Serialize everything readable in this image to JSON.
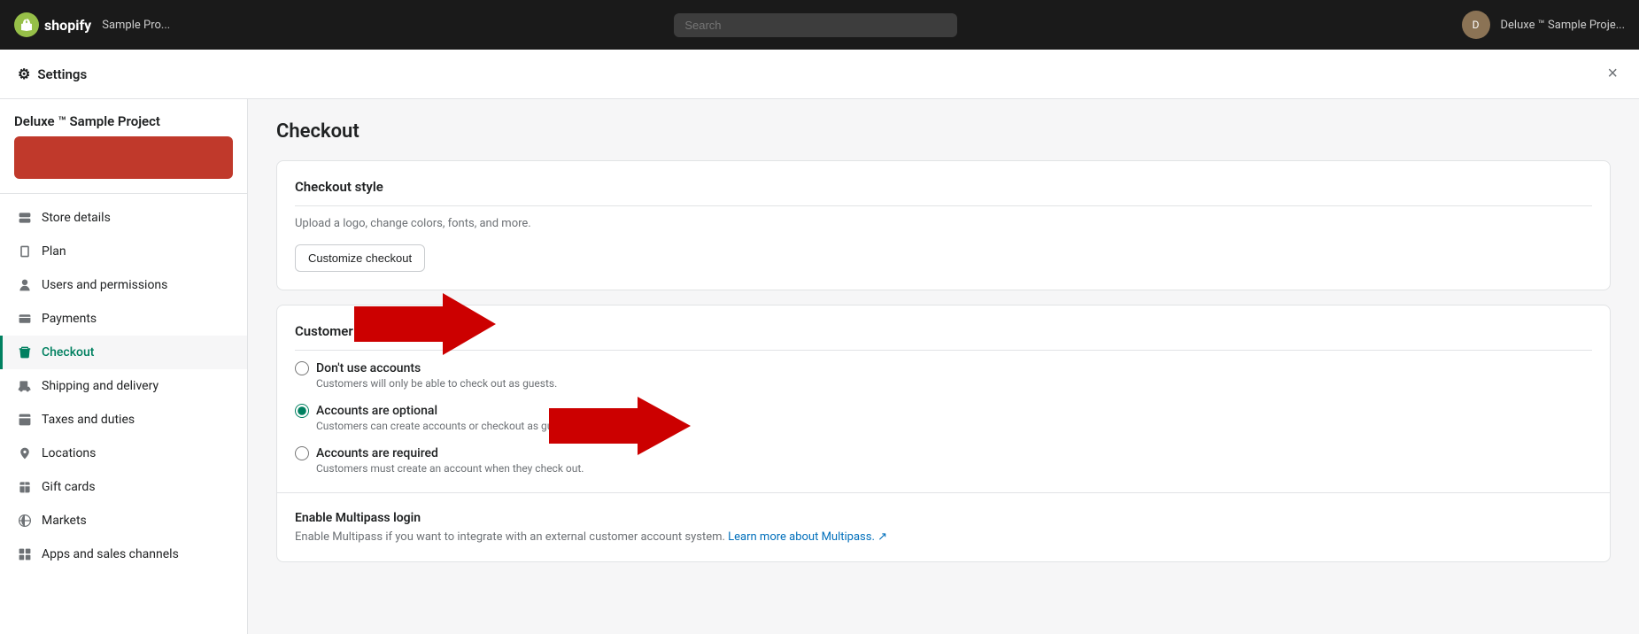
{
  "topbar": {
    "logo_text": "shopify",
    "store_name": "Sample Pro...",
    "search_placeholder": "Search",
    "user_label": "Deluxe ™ Sample Proje..."
  },
  "settings": {
    "title": "Settings",
    "close_label": "×"
  },
  "sidebar": {
    "store_title": "Deluxe ™ Sample Project",
    "nav_items": [
      {
        "id": "store-details",
        "label": "Store details",
        "icon": "🏪"
      },
      {
        "id": "plan",
        "label": "Plan",
        "icon": "📄"
      },
      {
        "id": "users-permissions",
        "label": "Users and permissions",
        "icon": "👤"
      },
      {
        "id": "payments",
        "label": "Payments",
        "icon": "💳"
      },
      {
        "id": "checkout",
        "label": "Checkout",
        "icon": "🛒",
        "active": true
      },
      {
        "id": "shipping-delivery",
        "label": "Shipping and delivery",
        "icon": "🚚"
      },
      {
        "id": "taxes-duties",
        "label": "Taxes and duties",
        "icon": "🏷️"
      },
      {
        "id": "locations",
        "label": "Locations",
        "icon": "📍"
      },
      {
        "id": "gift-cards",
        "label": "Gift cards",
        "icon": "🎁"
      },
      {
        "id": "markets",
        "label": "Markets",
        "icon": "🌐"
      },
      {
        "id": "apps-sales-channels",
        "label": "Apps and sales channels",
        "icon": "⬛"
      }
    ]
  },
  "main": {
    "page_title": "Checkout",
    "checkout_style": {
      "section_title": "Checkout style",
      "description": "Upload a logo, change colors, fonts, and more.",
      "customize_btn": "Customize checkout"
    },
    "customer_accounts": {
      "section_title": "Customer accounts",
      "options": [
        {
          "id": "no-accounts",
          "label": "Don't use accounts",
          "description": "Customers will only be able to check out as guests.",
          "checked": false
        },
        {
          "id": "optional-accounts",
          "label": "Accounts are optional",
          "description": "Customers can create accounts or checkout as guests.",
          "checked": true
        },
        {
          "id": "required-accounts",
          "label": "Accounts are required",
          "description": "Customers must create an account when they check out.",
          "checked": false
        }
      ]
    },
    "multipass": {
      "section_title": "Enable Multipass login",
      "description": "Enable Multipass if you want to integrate with an external customer account system.",
      "link_text": "Learn more about Multipass.",
      "link_icon": "↗"
    }
  }
}
